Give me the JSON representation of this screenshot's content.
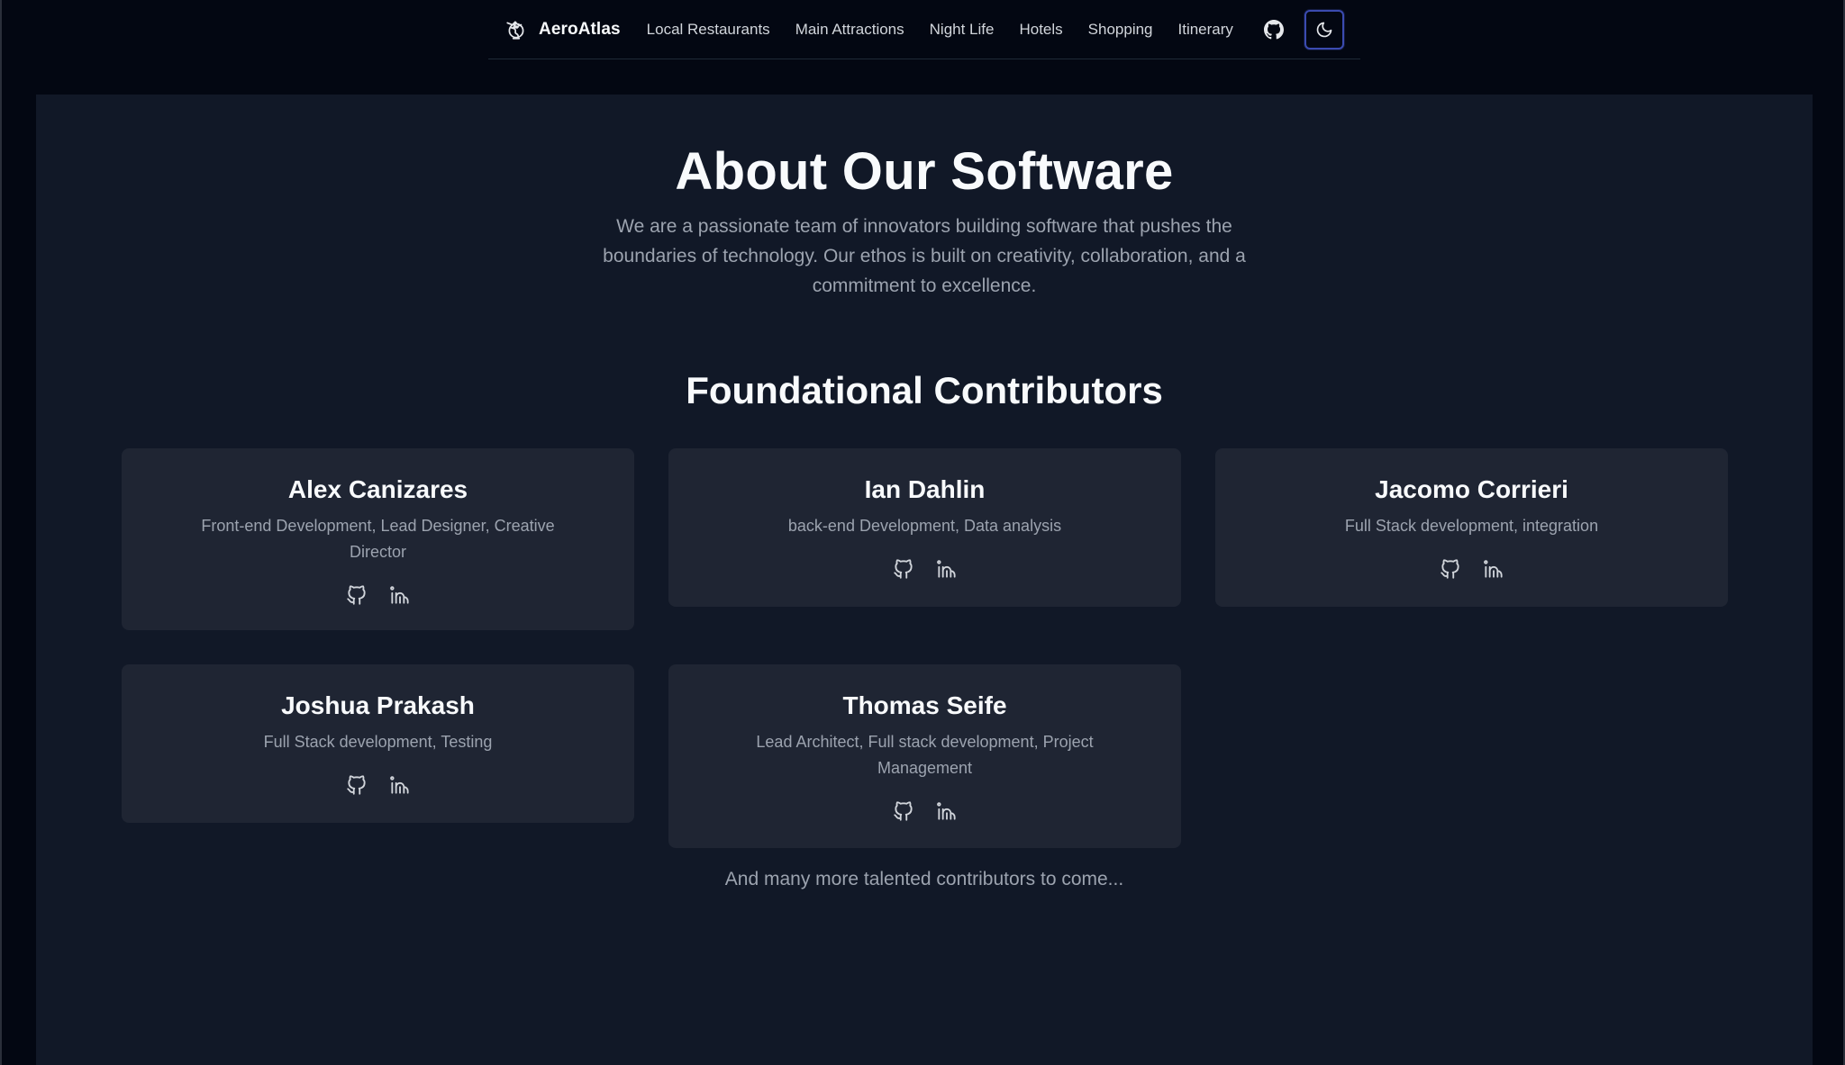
{
  "nav": {
    "brand": "AeroAtlas",
    "links": [
      {
        "label": "Local Restaurants"
      },
      {
        "label": "Main Attractions"
      },
      {
        "label": "Night Life"
      },
      {
        "label": "Hotels"
      },
      {
        "label": "Shopping"
      },
      {
        "label": "Itinerary"
      }
    ],
    "icons": {
      "logo": "globe-plane-icon",
      "github": "github-icon",
      "theme_toggle": "moon-icon"
    }
  },
  "hero": {
    "title": "About Our Software",
    "description": "We are a passionate team of innovators building software that pushes the boundaries of technology. Our ethos is built on creativity, collaboration, and a commitment to excellence."
  },
  "contributors": {
    "title": "Foundational Contributors",
    "members": [
      {
        "name": "Alex Canizares",
        "role": "Front-end Development, Lead Designer, Creative Director"
      },
      {
        "name": "Ian Dahlin",
        "role": "back-end Development, Data analysis"
      },
      {
        "name": "Jacomo Corrieri",
        "role": "Full Stack development, integration"
      },
      {
        "name": "Joshua Prakash",
        "role": "Full Stack development, Testing"
      },
      {
        "name": "Thomas Seife",
        "role": "Lead Architect, Full stack development, Project Management"
      }
    ],
    "link_icons": [
      "github-icon",
      "linkedin-icon"
    ],
    "footer": "And many more talented contributors to come..."
  },
  "colors": {
    "page_bg": "#030712",
    "panel_bg": "#111827",
    "card_bg": "#1f2533",
    "muted_text": "#9ca3af",
    "accent_border": "#3b4bb0"
  }
}
